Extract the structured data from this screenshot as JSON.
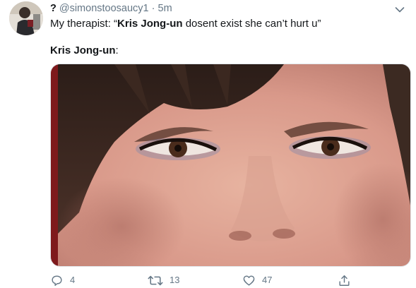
{
  "tweet": {
    "display_name": "?",
    "handle": "@simonstoosaucy1",
    "separator": "·",
    "time": "5m",
    "line1_prefix": "My therapist: “",
    "line1_bold": "Kris Jong-un",
    "line1_suffix": " dosent exist she can’t hurt u”",
    "line2_bold": "Kris Jong-un",
    "line2_suffix": ":"
  },
  "actions": {
    "reply_count": "4",
    "retweet_count": "13",
    "like_count": "47"
  },
  "icons": {
    "avatar": "avatar",
    "caret": "chevron-down-icon",
    "reply": "reply-icon",
    "retweet": "retweet-icon",
    "like": "heart-icon",
    "share": "share-icon"
  },
  "colors": {
    "text": "#14171a",
    "secondary": "#657786"
  }
}
